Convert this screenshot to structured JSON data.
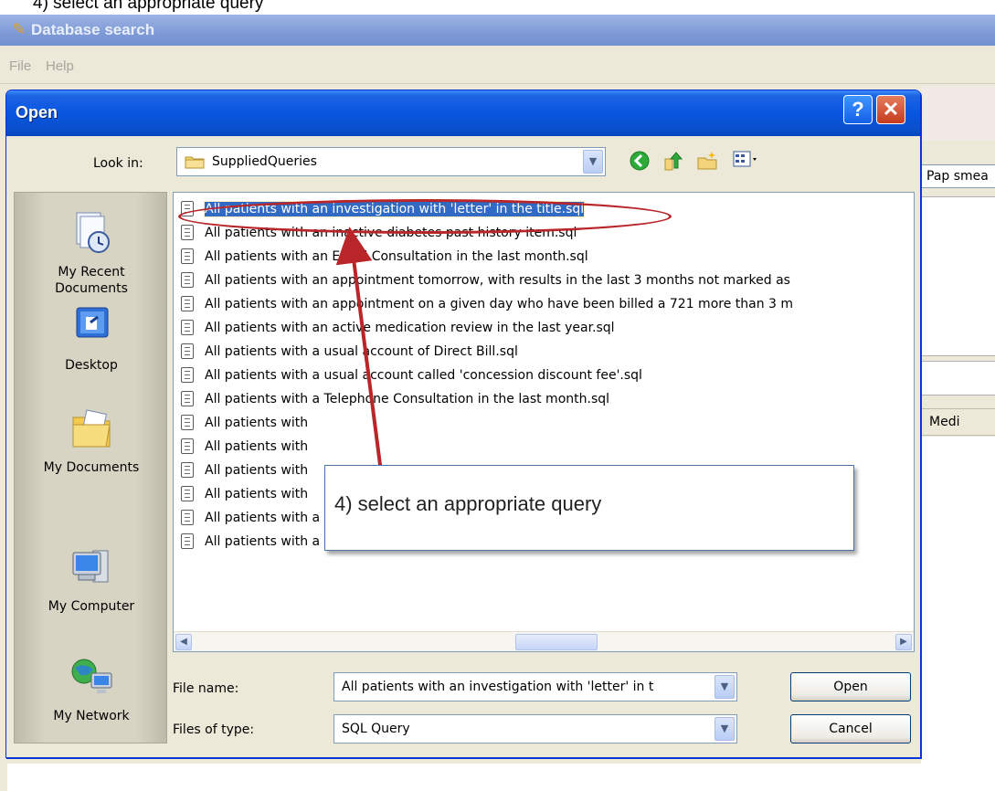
{
  "caption": "4) select an appropriate query",
  "app": {
    "title": "Database search",
    "menu": [
      "File",
      "Help"
    ],
    "right_field_value": "Pap smea",
    "right_column_header": "Medi"
  },
  "dialog": {
    "title": "Open",
    "help_label": "?",
    "close_label": "✕",
    "look_in_label": "Look in:",
    "look_in_value": "SuppliedQueries",
    "places": [
      {
        "label_line1": "My Recent",
        "label_line2": "Documents",
        "icon": "recent-documents-icon"
      },
      {
        "label_line1": "Desktop",
        "label_line2": "",
        "icon": "desktop-icon"
      },
      {
        "label_line1": "My Documents",
        "label_line2": "",
        "icon": "my-documents-icon"
      },
      {
        "label_line1": "My Computer",
        "label_line2": "",
        "icon": "my-computer-icon"
      },
      {
        "label_line1": "My Network",
        "label_line2": "",
        "icon": "my-network-icon"
      }
    ],
    "files": [
      "All patients with an investigation with 'letter' in the title.sql",
      "All patients with an inactive diabetes past history item.sql",
      "All patients with an Email Consultation in the last month.sql",
      "All patients with an appointment tomorrow, with results in the last 3 months not marked as",
      "All patients with an appointment on a given day who have been billed a 721 more than 3 m",
      "All patients with an active medication review in the last year.sql",
      "All patients with a usual account of Direct Bill.sql",
      "All patients with a usual account called 'concession discount fee'.sql",
      "All patients with a Telephone Consultation in the last month.sql",
      "All patients with",
      "All patients with",
      "All patients with",
      "All patients with",
      "All patients with a neurological condition.sql",
      "All patients with a Locum Consultation in the last month.sql"
    ],
    "file_name_label": "File name:",
    "file_name_value": "All patients with an investigation with 'letter' in t",
    "files_of_type_label": "Files of type:",
    "files_of_type_value": "SQL Query",
    "open_button": "Open",
    "cancel_button": "Cancel"
  },
  "callout": {
    "text": "4) select an appropriate query"
  },
  "colors": {
    "selection": "#316ac5",
    "annotation": "#b8262a",
    "titlebar": "#0856e0"
  }
}
